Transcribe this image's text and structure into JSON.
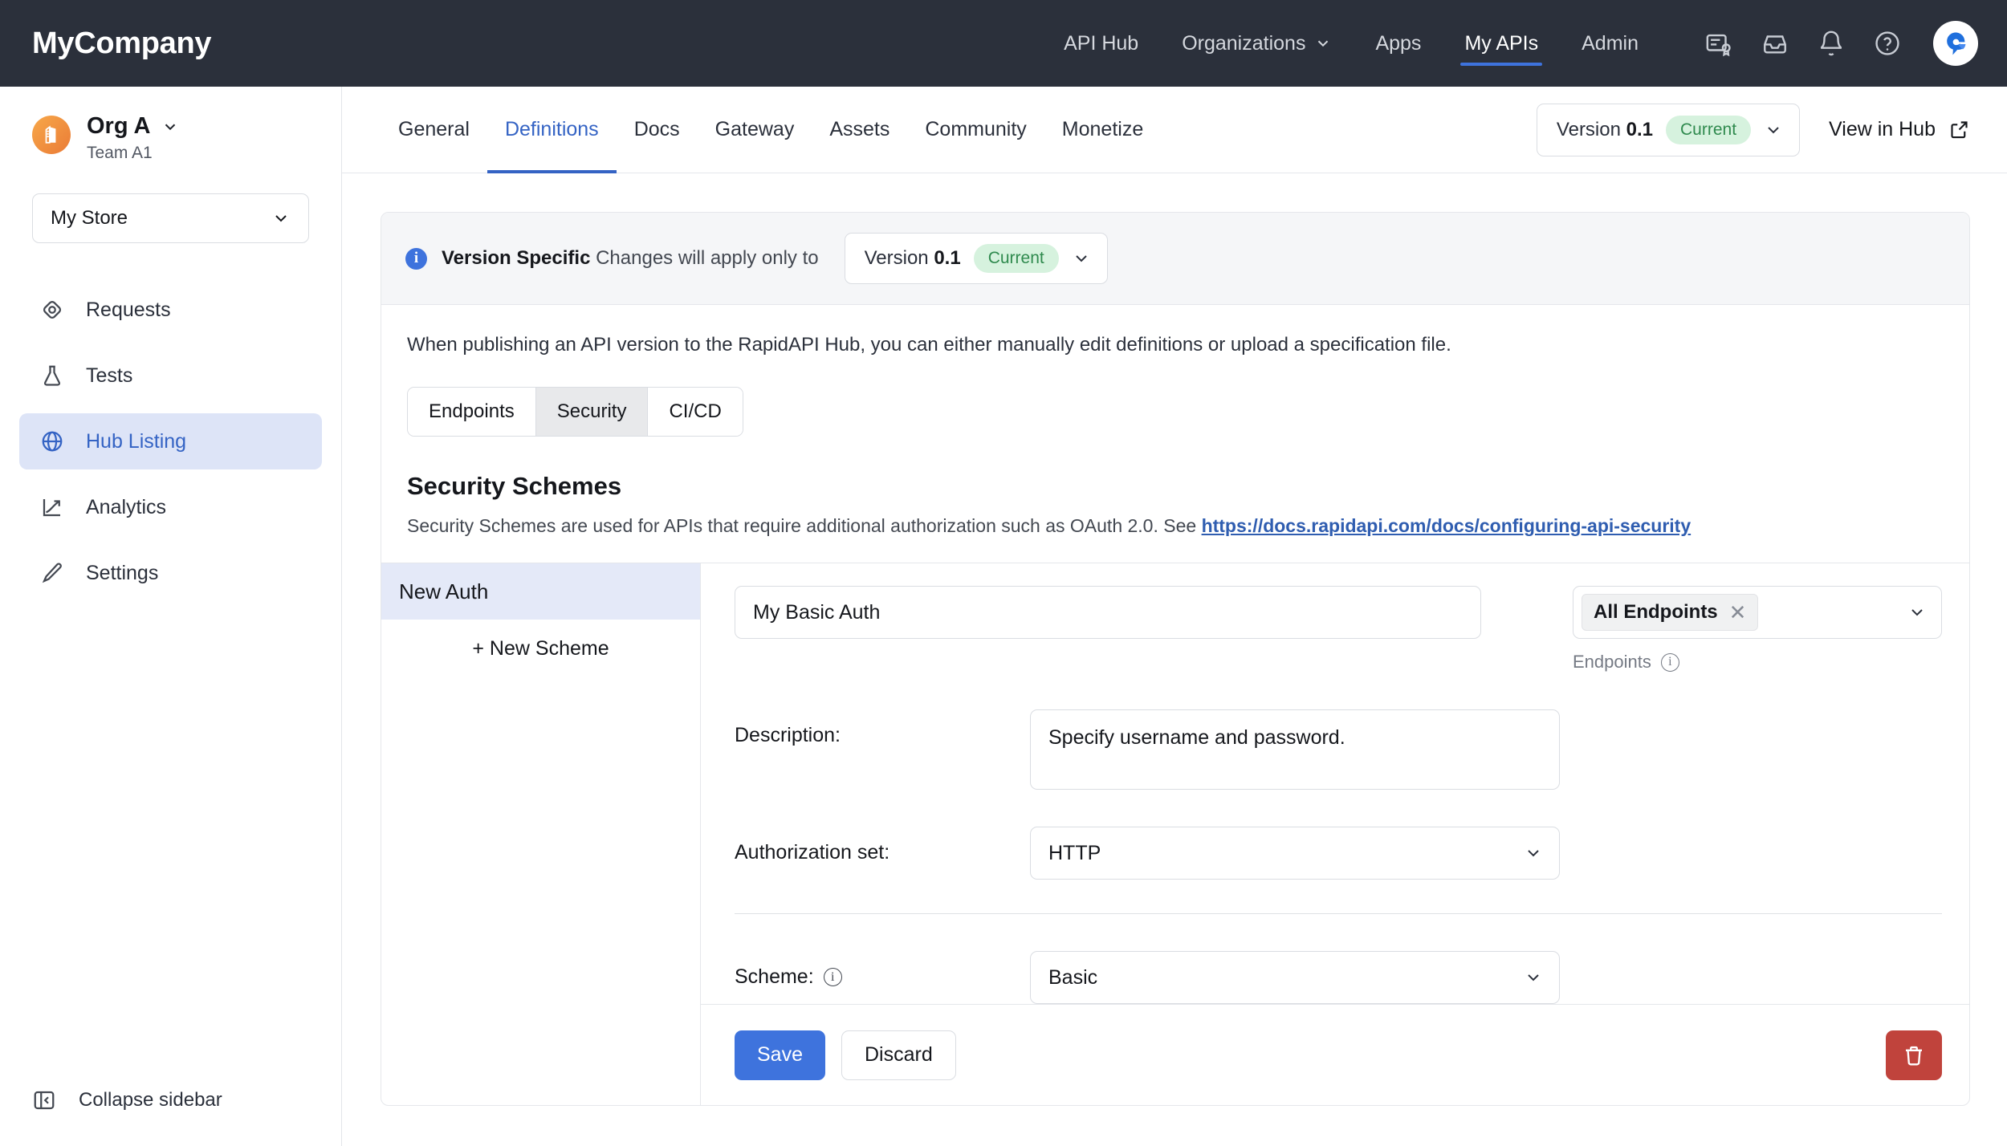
{
  "topbar": {
    "brand": "MyCompany",
    "nav": [
      {
        "label": "API Hub",
        "active": false,
        "caret": false
      },
      {
        "label": "Organizations",
        "active": false,
        "caret": true
      },
      {
        "label": "Apps",
        "active": false,
        "caret": false
      },
      {
        "label": "My APIs",
        "active": true,
        "caret": false
      },
      {
        "label": "Admin",
        "active": false,
        "caret": false
      }
    ],
    "icons": [
      "license-icon",
      "inbox-icon",
      "bell-icon",
      "help-icon"
    ],
    "avatar_label": "R"
  },
  "sidebar": {
    "org_name": "Org A",
    "org_team": "Team A1",
    "store_label": "My Store",
    "items": [
      {
        "label": "Requests",
        "icon": "requests-icon",
        "active": false
      },
      {
        "label": "Tests",
        "icon": "flask-icon",
        "active": false
      },
      {
        "label": "Hub Listing",
        "icon": "globe-icon",
        "active": true
      },
      {
        "label": "Analytics",
        "icon": "analytics-icon",
        "active": false
      },
      {
        "label": "Settings",
        "icon": "pencil-icon",
        "active": false
      }
    ],
    "collapse_label": "Collapse sidebar"
  },
  "tabbar": {
    "tabs": [
      {
        "label": "General",
        "active": false
      },
      {
        "label": "Definitions",
        "active": true
      },
      {
        "label": "Docs",
        "active": false
      },
      {
        "label": "Gateway",
        "active": false
      },
      {
        "label": "Assets",
        "active": false
      },
      {
        "label": "Community",
        "active": false
      },
      {
        "label": "Monetize",
        "active": false
      }
    ],
    "version_prefix": "Version",
    "version_number": "0.1",
    "version_badge": "Current",
    "view_in_hub": "View in Hub"
  },
  "banner": {
    "bold": "Version Specific",
    "text": "Changes will apply only to",
    "version_prefix": "Version",
    "version_number": "0.1",
    "version_badge": "Current"
  },
  "card": {
    "lead": "When publishing an API version to the RapidAPI Hub, you can either manually edit definitions or upload a specification file.",
    "segments": [
      {
        "label": "Endpoints",
        "active": false
      },
      {
        "label": "Security",
        "active": true
      },
      {
        "label": "CI/CD",
        "active": false
      }
    ],
    "section_title": "Security Schemes",
    "section_desc": "Security Schemes are used for APIs that require additional authorization such as OAuth 2.0. See ",
    "section_link": "https://docs.rapidapi.com/docs/configuring-api-security"
  },
  "schemes": {
    "items": [
      {
        "label": "New Auth",
        "active": true
      }
    ],
    "new_scheme_label": "+ New Scheme"
  },
  "detail": {
    "name_value": "My Basic Auth",
    "endpoints_chip": "All Endpoints",
    "endpoints_caption": "Endpoints",
    "description_label": "Description:",
    "description_value": "Specify username and password.",
    "authorization_label": "Authorization set:",
    "authorization_value": "HTTP",
    "scheme_label": "Scheme:",
    "scheme_value": "Basic",
    "save_label": "Save",
    "discard_label": "Discard",
    "delete_icon": "trash-icon"
  },
  "colors": {
    "topbar_bg": "#2b303b",
    "accent_blue": "#3e73dd",
    "link_blue": "#2f5db0",
    "active_nav_bg": "#dde4f7",
    "badge_green_bg": "#d6f2de",
    "badge_green_fg": "#2f8a4e",
    "danger_red": "#c0433c"
  }
}
